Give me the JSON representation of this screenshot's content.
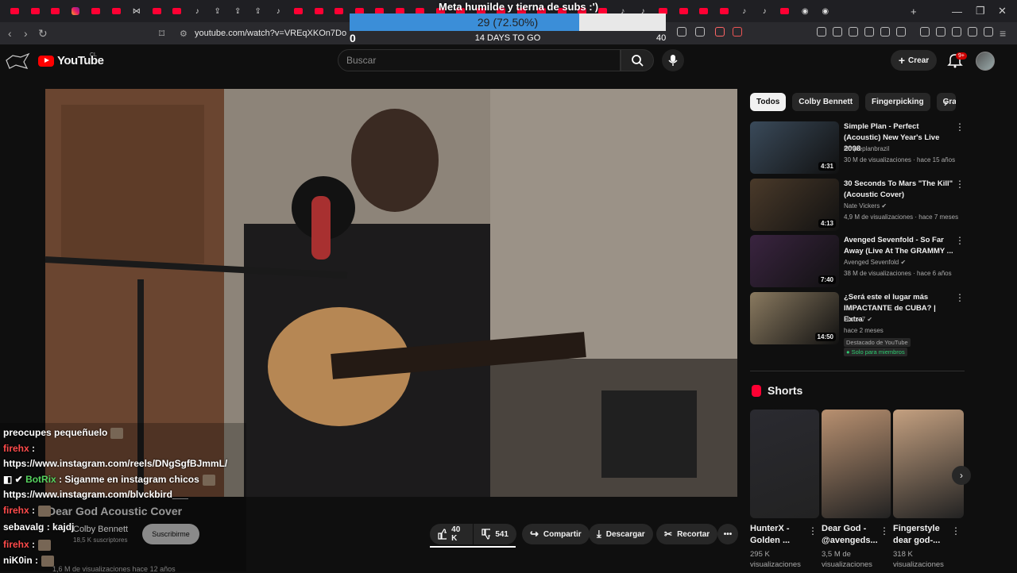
{
  "browser": {
    "tab_icons": [
      "yt",
      "yt",
      "yt",
      "ig",
      "yt",
      "yt",
      "ak",
      "yt",
      "yt",
      "tk",
      "up",
      "up",
      "up",
      "tk",
      "yt",
      "yt",
      "yt",
      "yt",
      "yt",
      "yt",
      "yt",
      "yt",
      "yt",
      "yt",
      "yt",
      "yt",
      "yt",
      "yt",
      "yt",
      "yt",
      "tk",
      "tk",
      "yt",
      "yt",
      "yt",
      "yt",
      "tk",
      "tk",
      "yt",
      "chrome",
      "chrome"
    ],
    "url": "youtube.com/watch?v=VREqXKOn7Do"
  },
  "overlay": {
    "title": "Meta humilde y tierna de subs :')",
    "progress_text": "29 (72.50%)",
    "progress_fraction": 0.725,
    "min_label": "0",
    "max_label": "40",
    "days_label": "14 DAYS TO GO"
  },
  "header": {
    "logo_text": "YouTube",
    "country": "CL",
    "search_placeholder": "Buscar",
    "create_label": "Crear",
    "notif_badge": "9+"
  },
  "chips": [
    "Todos",
    "Colby Bennett",
    "Fingerpicking",
    "Grab"
  ],
  "recommendations": [
    {
      "title": "Simple Plan - Perfect (Acoustic) New Year's Live 2008",
      "channel": "simpleplanbrazil",
      "verified": false,
      "meta": "30 M de visualizaciones · hace 15 años",
      "duration": "4:31",
      "color": "#3a4a5a"
    },
    {
      "title": "30 Seconds To Mars \"The Kill\" (Acoustic Cover)",
      "channel": "Nate Vickers",
      "verified": true,
      "meta": "4,9 M de visualizaciones · hace 7 meses",
      "duration": "4:13",
      "color": "#4a3a2a"
    },
    {
      "title": "Avenged Sevenfold - So Far Away (Live At The GRAMMY ...",
      "channel": "Avenged Sevenfold",
      "verified": true,
      "meta": "38 M de visualizaciones · hace 6 años",
      "duration": "7:40",
      "color": "#3a2440"
    },
    {
      "title": "¿Será este el lugar más IMPACTANTE de CUBA? | Extra",
      "channel": "Claux.7",
      "verified": true,
      "meta": "hace 2 meses",
      "duration": "14:50",
      "color": "#8a7a60",
      "pill1": "Destacado de YouTube",
      "pill2": "Solo para miembros"
    }
  ],
  "shorts": {
    "heading": "Shorts",
    "items": [
      {
        "title": "HunterX - Golden ...",
        "views": "295 K visualizaciones",
        "color": "#2a2a30"
      },
      {
        "title": "Dear God - @avengeds...",
        "views": "3,5 M de visualizaciones",
        "color": "#b89070"
      },
      {
        "title": "Fingerstyle dear god-...",
        "views": "318 K visualizaciones",
        "color": "#c4a080"
      }
    ]
  },
  "video": {
    "title": "Dear God Acoustic Cover",
    "channel_name": "Colby Bennett",
    "subscribers": "18,5 K suscriptores",
    "subscribe_label": "Suscribirme",
    "like_count": "40 K",
    "dislike_count": "541",
    "share_label": "Compartir",
    "download_label": "Descargar",
    "clip_label": "Recortar",
    "views_line": "1,6 M de visualizaciones  hace 12 años"
  },
  "chat": [
    {
      "user": "",
      "text": "preocupes pequeñuelo",
      "emote": true
    },
    {
      "user": "firehx",
      "text": ":",
      "emote": false
    },
    {
      "user": "",
      "text": "https://www.instagram.com/reels/DNgSgfBJmmL/",
      "emote": false
    },
    {
      "user": "BotRix",
      "text": ": Siganme en instagram chicos",
      "emote": true,
      "bot": true
    },
    {
      "user": "",
      "text": "https://www.instagram.com/blvckbird___",
      "emote": false
    },
    {
      "user": "firehx",
      "text": ":",
      "emote": true
    },
    {
      "user": "sebavalg",
      "text": ": kajdj",
      "emote": false,
      "white": true
    },
    {
      "user": "firehx",
      "text": ":",
      "emote": true
    },
    {
      "user": "niK0in",
      "text": ":",
      "emote": true,
      "white": true
    }
  ]
}
